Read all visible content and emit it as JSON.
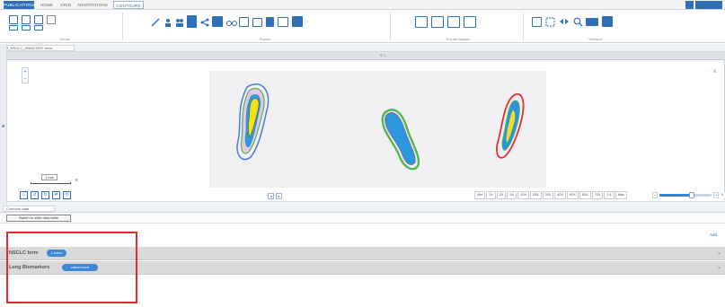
{
  "menubar": {
    "tabs": [
      "PUBLICATIONS",
      "HOME",
      "GRID",
      "ANNOTATIONS",
      "CONTOURS"
    ],
    "active_tab": "PUBLICATIONS"
  },
  "ribbon": {
    "groups": [
      {
        "label": "Server"
      },
      {
        "label": "Panels"
      },
      {
        "label": "Pre-set layouts"
      },
      {
        "label": "Viewport"
      }
    ]
  },
  "document_tab": {
    "label": "T_NSCLC_ANNOTATE.mrxs"
  },
  "viewer": {
    "header_label": "© ⌂",
    "top_marker": "1",
    "corner_mark": "x",
    "zoom_in": "+",
    "zoom_out": "−",
    "scale_label": "1 mm",
    "scale_close": "×",
    "page_prev": "◂",
    "page_next": "▸",
    "zoom_levels": [
      "Min",
      "1X",
      "2X",
      "5X",
      "10X",
      "20X",
      "30X",
      "40X",
      "60X",
      "80X",
      "70X",
      "1:1",
      "Max"
    ],
    "slider_fraction": 0.62,
    "slider_minus": "−",
    "slider_plus": "+",
    "slider_value": "0"
  },
  "bottom_panel": {
    "tab_label": "Contours data",
    "button_label": "Switch to slide data table",
    "add_label": "Add",
    "rows": [
      {
        "label": "NSCLC form",
        "pill": "1 added"
      },
      {
        "label": "Lung Biomarkers",
        "pill": "values found"
      }
    ],
    "chevron": "⌄"
  },
  "colors": {
    "accent": "#2f6fb6",
    "highlight": "#e02b2b",
    "pill": "#3d86d8"
  }
}
